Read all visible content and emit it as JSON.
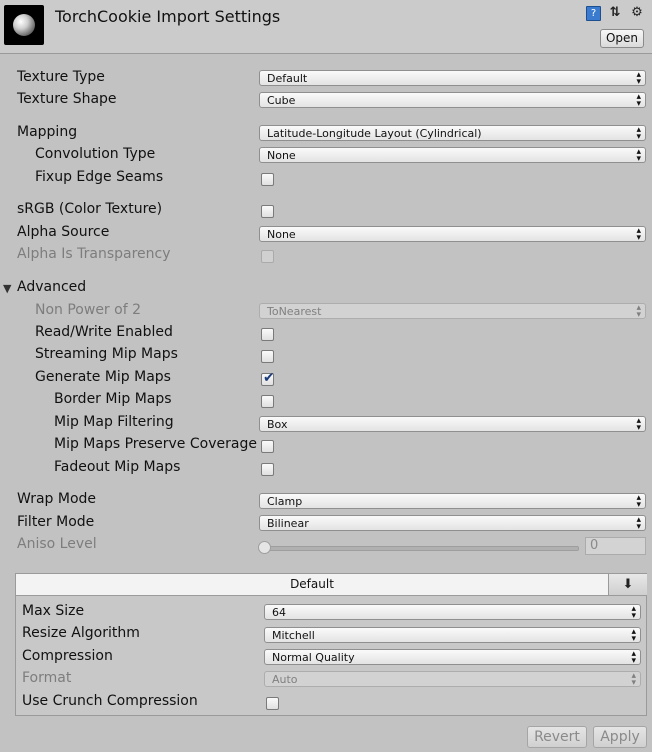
{
  "header": {
    "title": "TorchCookie Import Settings",
    "open_label": "Open"
  },
  "fields": {
    "texture_type": {
      "label": "Texture Type",
      "value": "Default"
    },
    "texture_shape": {
      "label": "Texture Shape",
      "value": "Cube"
    },
    "mapping": {
      "label": "Mapping",
      "value": "Latitude-Longitude Layout (Cylindrical)"
    },
    "convolution_type": {
      "label": "Convolution Type",
      "value": "None"
    },
    "fixup_edge_seams": {
      "label": "Fixup Edge Seams",
      "checked": false
    },
    "srgb": {
      "label": "sRGB (Color Texture)",
      "checked": false
    },
    "alpha_source": {
      "label": "Alpha Source",
      "value": "None"
    },
    "alpha_is_transparency": {
      "label": "Alpha Is Transparency",
      "checked": false,
      "disabled": true
    },
    "advanced": {
      "label": "Advanced",
      "expanded": true
    },
    "non_power_of_2": {
      "label": "Non Power of 2",
      "value": "ToNearest",
      "disabled": true
    },
    "read_write": {
      "label": "Read/Write Enabled",
      "checked": false
    },
    "streaming_mip_maps": {
      "label": "Streaming Mip Maps",
      "checked": false
    },
    "generate_mip_maps": {
      "label": "Generate Mip Maps",
      "checked": true
    },
    "border_mip_maps": {
      "label": "Border Mip Maps",
      "checked": false
    },
    "mip_map_filtering": {
      "label": "Mip Map Filtering",
      "value": "Box"
    },
    "mip_maps_preserve_coverage": {
      "label": "Mip Maps Preserve Coverage",
      "checked": false
    },
    "fadeout_mip_maps": {
      "label": "Fadeout Mip Maps",
      "checked": false
    },
    "wrap_mode": {
      "label": "Wrap Mode",
      "value": "Clamp"
    },
    "filter_mode": {
      "label": "Filter Mode",
      "value": "Bilinear"
    },
    "aniso_level": {
      "label": "Aniso Level",
      "value": "0",
      "slider_fraction": 0.0,
      "disabled": true
    }
  },
  "platform": {
    "tab_label": "Default",
    "max_size": {
      "label": "Max Size",
      "value": "64"
    },
    "resize_algorithm": {
      "label": "Resize Algorithm",
      "value": "Mitchell"
    },
    "compression": {
      "label": "Compression",
      "value": "Normal Quality"
    },
    "format": {
      "label": "Format",
      "value": "Auto",
      "disabled": true
    },
    "use_crunch": {
      "label": "Use Crunch Compression",
      "checked": false
    }
  },
  "footer": {
    "revert_label": "Revert",
    "apply_label": "Apply"
  },
  "icons": {
    "help": "book-icon",
    "presets": "sliders-icon",
    "settings": "gear-icon",
    "download": "download-icon"
  },
  "colors": {
    "background": "#c2c2c2",
    "header": "#cbcbcb",
    "check": "#1b3c7a"
  }
}
